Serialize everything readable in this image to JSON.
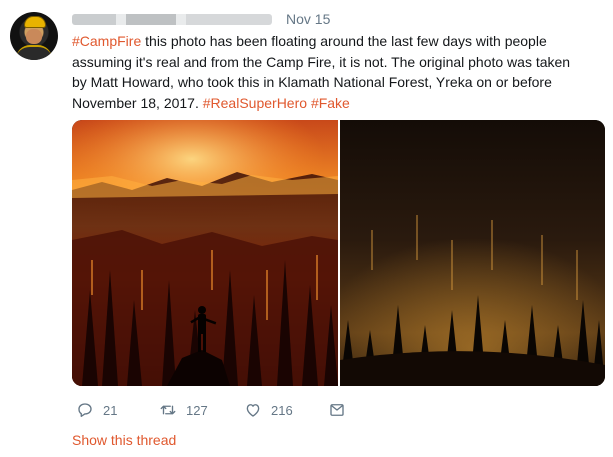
{
  "tweet": {
    "time": "Nov 15",
    "lines": [
      [
        {
          "t": "#CampFire",
          "tag": true
        },
        {
          "t": " this photo has been floating around the last few days with people",
          "tag": false
        }
      ],
      [
        {
          "t": "assuming it's real and from the Camp Fire, it is not. The original photo was taken",
          "tag": false
        }
      ],
      [
        {
          "t": "by Matt Howard, who took this in Klamath National Forest, Yreka on or before",
          "tag": false
        }
      ],
      [
        {
          "t": "November 18, 2017. ",
          "tag": false
        },
        {
          "t": "#RealSuperHero",
          "tag": true
        },
        {
          "t": " ",
          "tag": false
        },
        {
          "t": "#Fake",
          "tag": true
        }
      ]
    ]
  },
  "actions": {
    "reply_count": "21",
    "retweet_count": "127",
    "like_count": "216"
  },
  "show_thread_label": "Show this thread",
  "colors": {
    "accent": "#e0582e",
    "muted": "#657786",
    "text": "#14171a"
  },
  "icons": [
    "reply-icon",
    "retweet-icon",
    "like-icon",
    "direct-message-icon"
  ]
}
